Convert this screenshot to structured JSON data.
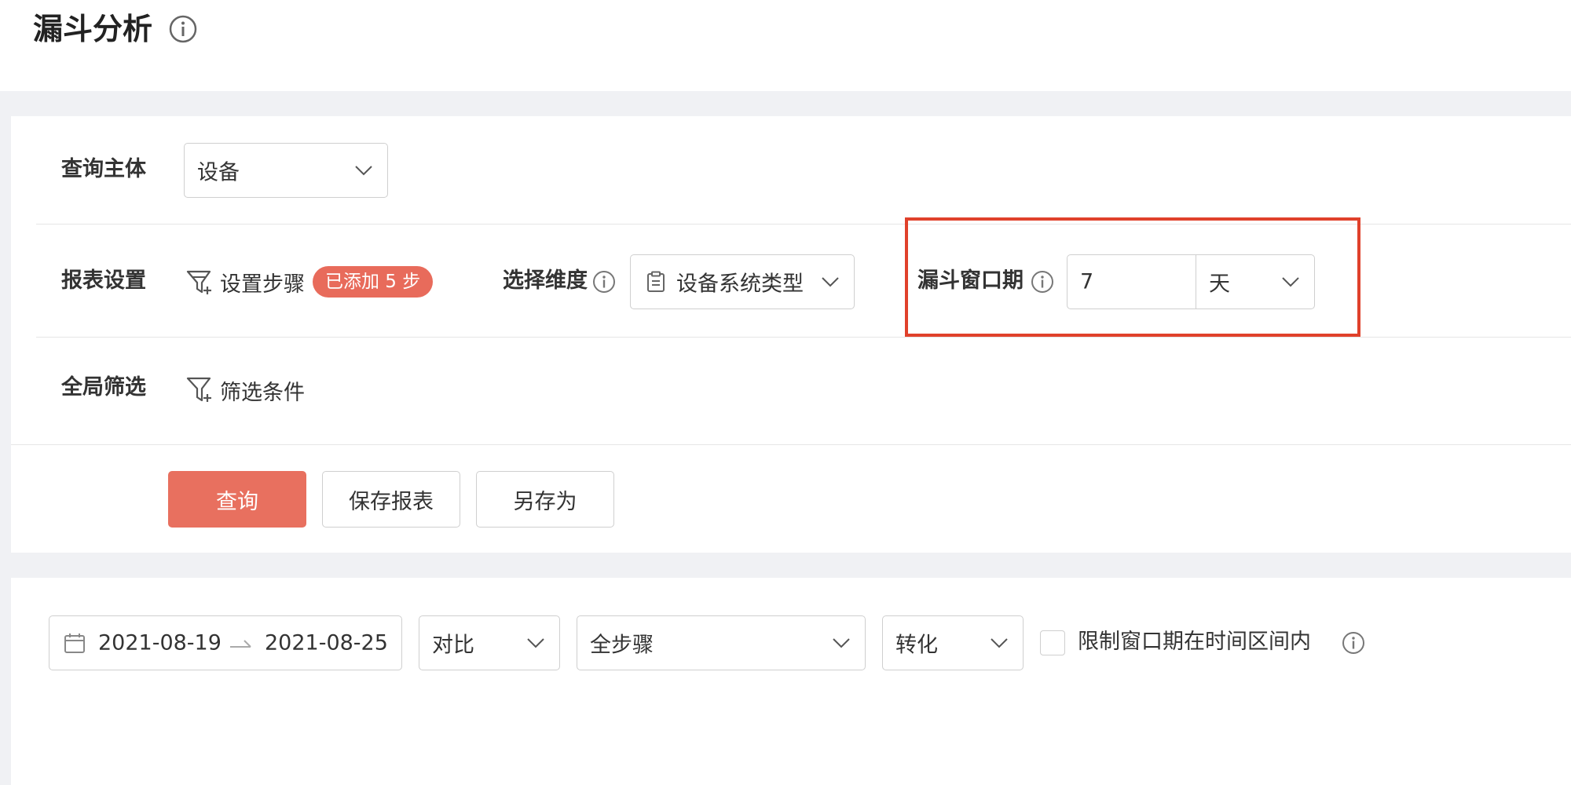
{
  "header": {
    "title": "漏斗分析",
    "info_icon": "info-circle-icon"
  },
  "query_subject": {
    "label": "查询主体",
    "value": "设备"
  },
  "report_settings": {
    "label": "报表设置",
    "set_steps_label": "设置步骤",
    "steps_badge": "已添加 5 步",
    "dimension_label": "选择维度",
    "dimension_value": "设备系统类型",
    "window_label": "漏斗窗口期",
    "window_value": "7",
    "window_unit": "天"
  },
  "global_filter": {
    "label": "全局筛选",
    "filter_action": "筛选条件"
  },
  "buttons": {
    "query": "查询",
    "save": "保存报表",
    "save_as": "另存为"
  },
  "toolbar": {
    "date_start": "2021-08-19",
    "date_end": "2021-08-25",
    "compare": "对比",
    "steps": "全步骤",
    "metric": "转化",
    "limit_checkbox_label": "限制窗口期在时间区间内"
  },
  "colors": {
    "primary": "#e8705f",
    "badge": "#e86b5b",
    "highlight": "#e0412b"
  }
}
